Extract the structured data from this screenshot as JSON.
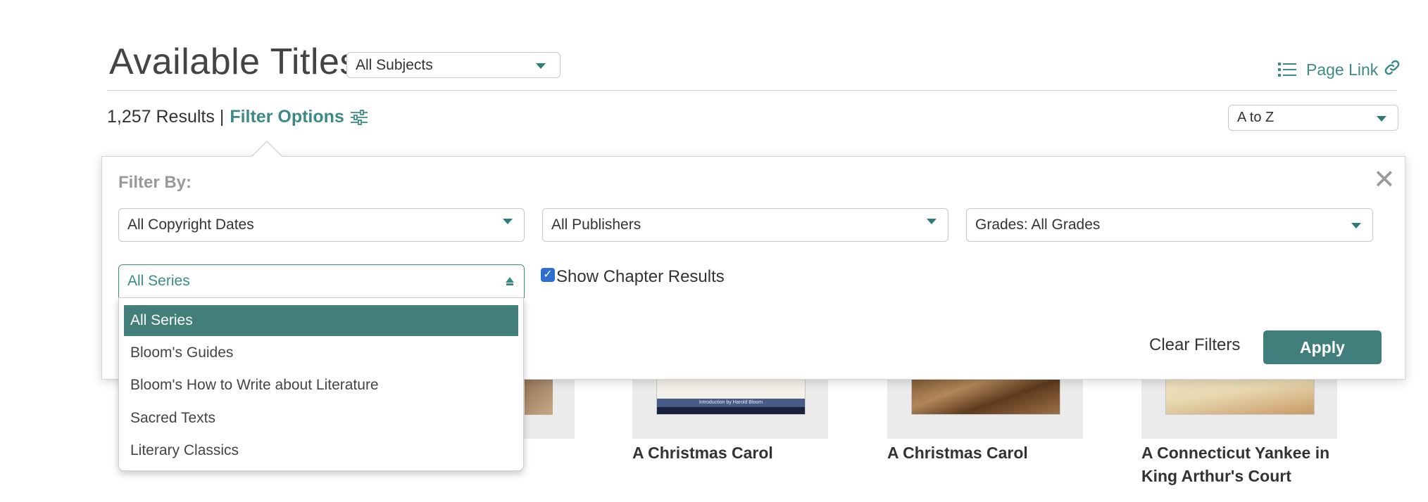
{
  "header": {
    "title": "Available Titles",
    "subject_select": "All Subjects",
    "page_link": "Page Link",
    "list_icon": "list-icon",
    "link_icon": "link-icon"
  },
  "results_bar": {
    "count_text": "1,257 Results |",
    "filter_options": "Filter Options",
    "filter_icon": "sliders-icon",
    "sort_select": "A to Z"
  },
  "filter_panel": {
    "heading": "Filter By:",
    "close_icon": "close-icon",
    "copyright_select": "All Copyright Dates",
    "publisher_select": "All Publishers",
    "grades_select": "Grades: All Grades",
    "series_select": "All Series",
    "show_chapter_label": "Show Chapter Results",
    "show_chapter_checked": true,
    "clear_label": "Clear Filters",
    "apply_label": "Apply",
    "series_options": [
      "All Series",
      "Bloom's Guides",
      "Bloom's How to Write about Literature",
      "Sacred Texts",
      "Literary Classics"
    ],
    "series_selected_index": 0
  },
  "books": [
    {
      "title": "A Christmas Carol",
      "cover_caption": "Introduction by Harold Bloom"
    },
    {
      "title": "A Christmas Carol"
    },
    {
      "title": "A Connecticut Yankee in King Arthur's Court"
    }
  ],
  "colors": {
    "accent": "#3c8a87",
    "button": "#417f7c",
    "selected_option": "#427f7b",
    "checkbox": "#2d6fd1"
  }
}
